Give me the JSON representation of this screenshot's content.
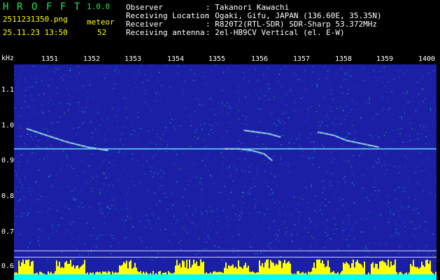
{
  "app": {
    "title_letters": [
      "H",
      "R",
      "O",
      "F",
      "F",
      "T"
    ],
    "version": "1.0.0",
    "filename": "2511231350.png",
    "datetime": "25.11.23 13:50",
    "meteor_label": "meteor",
    "meteor_count": "52"
  },
  "info": {
    "rows": [
      {
        "label": "Observer",
        "value": ": Takanori Kawachi"
      },
      {
        "label": "Receiving Location",
        "value": ": Ogaki, Gifu, JAPAN (136.60E, 35.35N)"
      },
      {
        "label": "Receiver",
        "value": ": R820T2(RTL-SDR) SDR-Sharp 53.372MHz"
      },
      {
        "label": "Receiving antenna",
        "value": ": 2el-HB9CV Vertical (el. E-W)"
      }
    ]
  },
  "axis": {
    "unit": "kHz",
    "x_ticks": [
      "1351",
      "1352",
      "1353",
      "1354",
      "1355",
      "1356",
      "1357",
      "1358",
      "1359",
      "1400"
    ],
    "y_ticks": [
      "1.1",
      "1.0",
      "0.9",
      "0.8",
      "0.7",
      "0.6"
    ]
  },
  "chart_data": {
    "type": "heatmap",
    "xlabel": "",
    "ylabel": "kHz",
    "x_categories": [
      "1351",
      "1352",
      "1353",
      "1354",
      "1355",
      "1356",
      "1357",
      "1358",
      "1359",
      "1400"
    ],
    "ylim": [
      0.58,
      1.16
    ],
    "carrier_khz": 0.91,
    "traces": [
      {
        "x": [
          13500,
          13505,
          13510,
          13515,
          13520
        ],
        "y": [
          0.97,
          0.95,
          0.93,
          0.915,
          0.905
        ]
      },
      {
        "x": [
          13548,
          13552,
          13555,
          13558,
          13560
        ],
        "y": [
          0.91,
          0.91,
          0.905,
          0.895,
          0.875
        ]
      },
      {
        "x": [
          13553,
          13556,
          13559,
          13562
        ],
        "y": [
          0.965,
          0.96,
          0.955,
          0.945
        ]
      },
      {
        "x": [
          13571,
          13575,
          13578,
          13582,
          13586
        ],
        "y": [
          0.96,
          0.95,
          0.935,
          0.925,
          0.915
        ]
      }
    ],
    "colors": {
      "background": "#1b1fa6",
      "noise_hot": "#19d6ff",
      "signal": "#ff3030",
      "activity": "#ffff00",
      "floor": "#00ffff"
    }
  }
}
